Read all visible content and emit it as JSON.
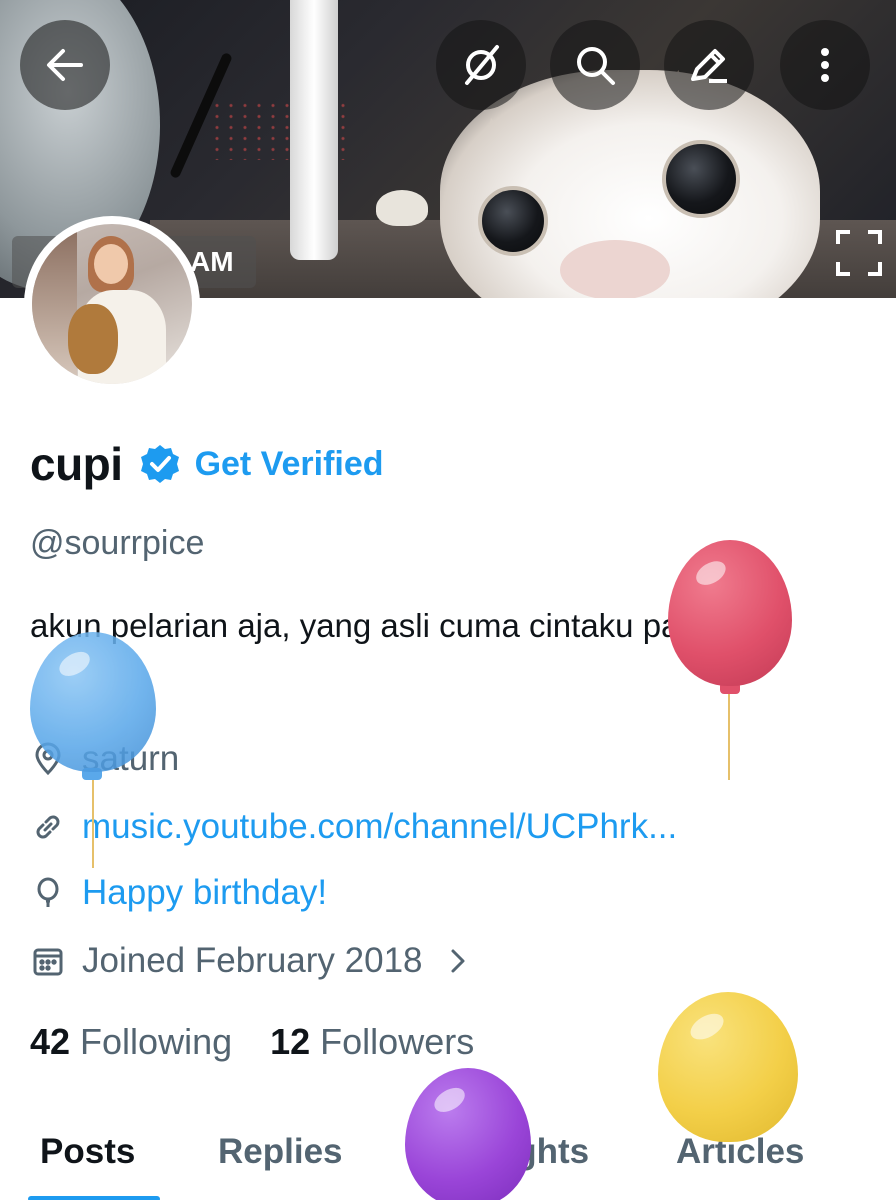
{
  "banner": {
    "timestamp_fragment": "AM"
  },
  "top_actions": {
    "back": "back-arrow-icon",
    "grok": "grok-icon",
    "search": "search-icon",
    "edit": "edit-pencil-icon",
    "more": "more-vertical-icon"
  },
  "profile": {
    "name": "cupi",
    "get_verified": "Get Verified",
    "handle": "@sourrpice",
    "bio": "akun pelarian aja, yang asli cuma cintaku padamu",
    "location": "saturn",
    "website": "music.youtube.com/channel/UCPhrk...",
    "birthday": "Happy birthday!",
    "joined": "Joined February 2018",
    "following_count": "42",
    "following_label": "Following",
    "followers_count": "12",
    "followers_label": "Followers"
  },
  "tabs": [
    {
      "label": "Posts",
      "active": true
    },
    {
      "label": "Replies",
      "active": false
    },
    {
      "label": "Highlights",
      "active": false
    },
    {
      "label": "Articles",
      "active": false
    }
  ],
  "colors": {
    "accent": "#1d9bf0",
    "text_primary": "#0f1419",
    "text_secondary": "#536471",
    "balloon_red": "#e0506a",
    "balloon_blue": "#5aa8ea",
    "balloon_yellow": "#f3cf48",
    "balloon_purple": "#9a45d8"
  }
}
